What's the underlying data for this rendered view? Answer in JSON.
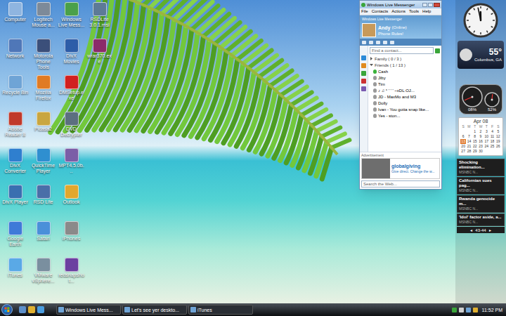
{
  "desktop_icons": [
    {
      "label": "Computer"
    },
    {
      "label": "Network"
    },
    {
      "label": "Recycle Bin"
    },
    {
      "label": "Adobe Reader 8"
    },
    {
      "label": "DivX Converter"
    },
    {
      "label": "DivX Player"
    },
    {
      "label": "Google Earth"
    },
    {
      "label": "iTunes"
    },
    {
      "label": "Logitech Mouse a..."
    },
    {
      "label": "Motorola Phone Tools"
    },
    {
      "label": "Mozilla Firefox"
    },
    {
      "label": "Picasa2"
    },
    {
      "label": "QuickTime Player"
    },
    {
      "label": "RSD Lite"
    },
    {
      "label": "Safari"
    },
    {
      "label": "VMware vSphere..."
    },
    {
      "label": "Windows Live Mess..."
    },
    {
      "label": "DivX Movies"
    },
    {
      "label": "DMSetup.exe"
    },
    {
      "label": "DVD Decrypter"
    },
    {
      "label": "MPT4.5.0b..."
    },
    {
      "label": "Outlook"
    },
    {
      "label": "iPhones"
    },
    {
      "label": "redsnapshot..."
    },
    {
      "label": "RSDLite 3.0.1.msi"
    },
    {
      "label": "wrar370.exe"
    }
  ],
  "messenger": {
    "title": "Windows Live Messenger",
    "menu": [
      "File",
      "Contacts",
      "Actions",
      "Tools",
      "Help"
    ],
    "brand": "Windows Live Messenger",
    "user": {
      "name": "Andy",
      "status": "(Online)",
      "message": "Phone Rules!"
    },
    "search_placeholder": "Find a contact...",
    "groups": [
      {
        "label": "Family ( 0 / 3 )",
        "expanded": false,
        "contacts": []
      },
      {
        "label": "Friends ( 1 / 13 )",
        "expanded": true,
        "contacts": [
          {
            "name": "Cash",
            "online": true
          },
          {
            "name": "Jiby",
            "online": false
          },
          {
            "name": "Tim",
            "online": false
          },
          {
            "name": "♪ ♫ ° ' ' ' ~xDL:OJ...",
            "online": false
          },
          {
            "name": "JD - MaxMo and M3",
            "online": false
          },
          {
            "name": "Dolly",
            "online": false
          },
          {
            "name": "Ivan - You gotta snap like...",
            "online": false
          },
          {
            "name": "Yes - ston...",
            "online": false
          }
        ]
      }
    ],
    "ad": {
      "label": "Advertisement",
      "brand": "globalgiving",
      "tagline": "Give direct. Change the w..."
    },
    "web_search_placeholder": "Search the Web..."
  },
  "sidebar": {
    "clock": {
      "hour": 11,
      "minute": 58
    },
    "weather": {
      "temperature": "55°",
      "city": "Columbus, GA"
    },
    "cpu_meter": {
      "gauges": [
        {
          "level": 0.08,
          "reading": "08%"
        },
        {
          "level": 0.52,
          "reading": "52%"
        }
      ]
    },
    "calendar": {
      "month": "Apr 08",
      "weekdays": [
        "S",
        "M",
        "T",
        "W",
        "T",
        "F",
        "S"
      ],
      "leading_blank_days": 2,
      "days": [
        {
          "label": "1",
          "selected": false
        },
        {
          "label": "2",
          "selected": false
        },
        {
          "label": "3",
          "selected": false
        },
        {
          "label": "4",
          "selected": false
        },
        {
          "label": "5",
          "selected": false
        },
        {
          "label": "6",
          "selected": false
        },
        {
          "label": "7",
          "selected": false
        },
        {
          "label": "8",
          "selected": false
        },
        {
          "label": "9",
          "selected": false
        },
        {
          "label": "10",
          "selected": false
        },
        {
          "label": "11",
          "selected": false
        },
        {
          "label": "12",
          "selected": false
        },
        {
          "label": "13",
          "selected": true
        },
        {
          "label": "14",
          "selected": false
        },
        {
          "label": "15",
          "selected": false
        },
        {
          "label": "16",
          "selected": false
        },
        {
          "label": "17",
          "selected": false
        },
        {
          "label": "18",
          "selected": false
        },
        {
          "label": "19",
          "selected": false
        },
        {
          "label": "20",
          "selected": false
        },
        {
          "label": "21",
          "selected": false
        },
        {
          "label": "22",
          "selected": false
        },
        {
          "label": "23",
          "selected": false
        },
        {
          "label": "24",
          "selected": false
        },
        {
          "label": "25",
          "selected": false
        },
        {
          "label": "26",
          "selected": false
        },
        {
          "label": "27",
          "selected": false
        },
        {
          "label": "28",
          "selected": false
        },
        {
          "label": "29",
          "selected": false
        },
        {
          "label": "30",
          "selected": false
        }
      ]
    },
    "feed": {
      "items": [
        {
          "title": "Shocking elimination...",
          "source": "MSNBC N..."
        },
        {
          "title": "Californian sues pag...",
          "source": "MSNBC N..."
        },
        {
          "title": "Rwanda genocide m...",
          "source": "MSNBC N..."
        },
        {
          "title": "'Idol' factor aside, a...",
          "source": "MSNBC N..."
        }
      ],
      "prev": "◂",
      "pager": "43-44",
      "next": "▸"
    }
  },
  "taskbar": {
    "tasks": [
      {
        "label": "Windows Live Mess...",
        "selected": false
      },
      {
        "label": "Let's see yer deskto...",
        "selected": false
      },
      {
        "label": "iTunes",
        "selected": false
      }
    ],
    "clock": "11:52 PM"
  }
}
